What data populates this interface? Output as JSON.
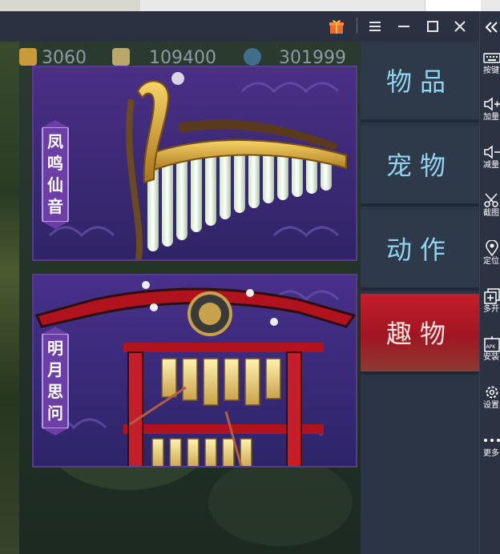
{
  "window": {
    "controls": {
      "gift_icon": "gift-icon",
      "menu_icon": "menu-icon",
      "minimize_icon": "minimize-icon",
      "maximize_icon": "maximize-icon",
      "close_icon": "close-icon",
      "collapse_icon": "double-chevron-left-icon"
    }
  },
  "resources": [
    {
      "icon": "gold-ingot-icon",
      "value": "3060"
    },
    {
      "icon": "silver-ingot-icon",
      "value": "109400"
    },
    {
      "icon": "orb-icon",
      "value": "301999"
    }
  ],
  "cards": [
    {
      "label": "凤鸣仙音",
      "label_chars": [
        "凤",
        "鸣",
        "仙",
        "音"
      ],
      "item": "panpipe-instrument"
    },
    {
      "label": "明月思问",
      "label_chars": [
        "明",
        "月",
        "思",
        "问"
      ],
      "item": "chime-gong-frame"
    }
  ],
  "tabs": [
    {
      "label": "物品",
      "active": false
    },
    {
      "label": "宠物",
      "active": false
    },
    {
      "label": "动作",
      "active": false
    },
    {
      "label": "趣物",
      "active": true
    }
  ],
  "toolbar": [
    {
      "icon": "keyboard-icon",
      "label": "按键"
    },
    {
      "icon": "volume-up-icon",
      "label": "加量"
    },
    {
      "icon": "volume-down-icon",
      "label": "减量"
    },
    {
      "icon": "scissors-icon",
      "label": "截图"
    },
    {
      "icon": "location-pin-icon",
      "label": "定位"
    },
    {
      "icon": "multi-instance-icon",
      "label": "多开"
    },
    {
      "icon": "apk-install-icon",
      "label": "安装"
    },
    {
      "icon": "gear-icon",
      "label": "设置"
    },
    {
      "icon": "more-dots-icon",
      "label": "更多"
    }
  ],
  "colors": {
    "active_tab": "#b01a26",
    "tab_text": "#8fd3f0",
    "card_bg": "#3b2a6e",
    "label_bg": "#6b3fa6"
  }
}
